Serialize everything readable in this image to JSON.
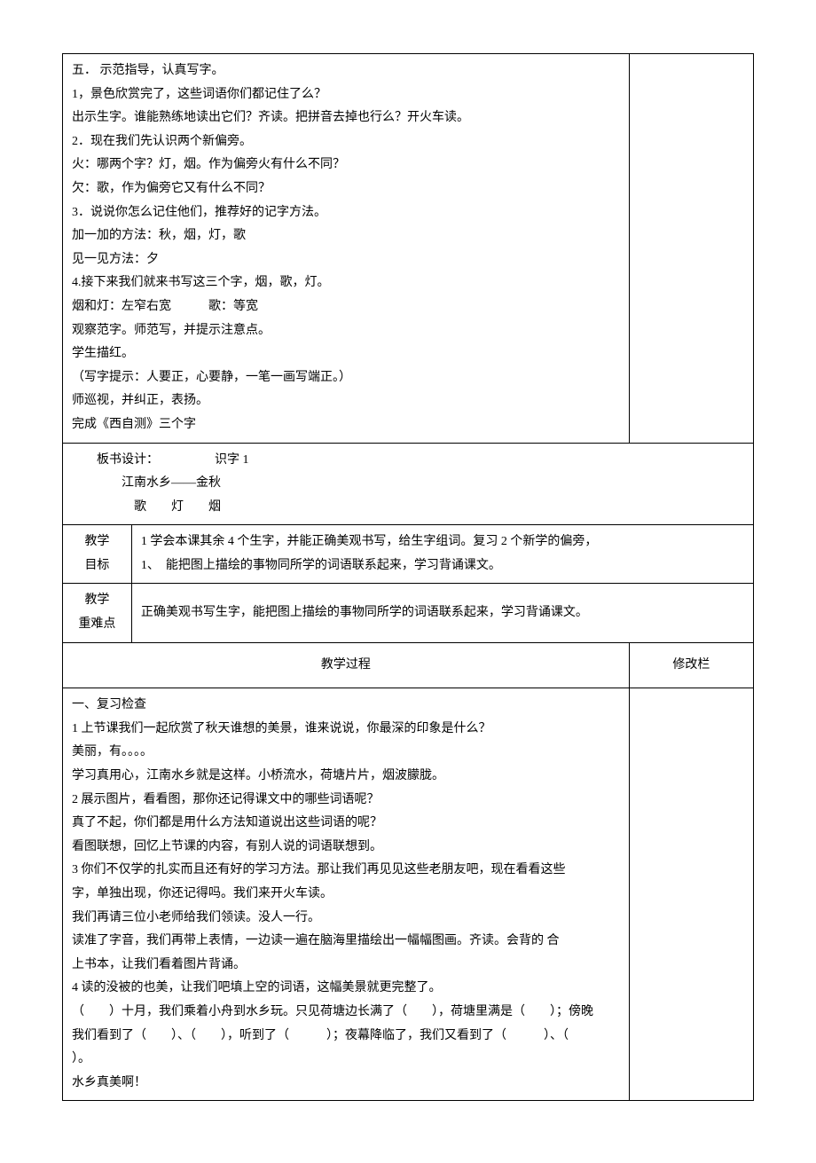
{
  "section1": {
    "lines": [
      "五．    示范指导，认真写字。",
      "1，景色欣赏完了，这些词语你们都记住了么？",
      "出示生字。谁能熟练地读出它们？齐读。把拼音去掉也行么？开火车读。",
      "2．现在我们先认识两个新偏旁。",
      "火：哪两个字？灯，烟。作为偏旁火有什么不同？",
      "欠：歌，作为偏旁它又有什么不同？",
      "3．说说你怎么记住他们，推荐好的记字方法。",
      "加一加的方法：秋，烟，灯，歌",
      "见一见方法：夕",
      "4.接下来我们就来书写这三个字，烟，歌，灯。",
      "烟和灯：左窄右宽　　　歌：等宽",
      "观察范字。师范写，并提示注意点。",
      "学生描红。",
      "（写字提示：人要正，心要静，一笔一画写端正。）",
      "师巡视，并纠正，表扬。",
      "完成《西自测》三个字"
    ]
  },
  "board": {
    "l1": "板书设计：　　　　　识字 1",
    "l2": "江南水乡——金秋",
    "l3": "歌　　灯　　烟"
  },
  "goals": {
    "label": "教学\n目标",
    "l1": "1 学会本课其余 4 个生字，并能正确美观书写，给生字组词。复习 2 个新学的偏旁，",
    "l2": "1、　能把图上描绘的事物同所学的词语联系起来，学习背诵课文。"
  },
  "difficulty": {
    "label": "教学\n重难点",
    "text": "正确美观书写生字，能把图上描绘的事物同所学的词语联系起来，学习背诵课文。"
  },
  "procHeader": {
    "left": "教学过程",
    "right": "修改栏"
  },
  "section2": {
    "lines": [
      "一、复习检查",
      "1 上节课我们一起欣赏了秋天谁想的美景，谁来说说，你最深的印象是什么？",
      "美丽，有。。。。",
      "学习真用心，江南水乡就是这样。小桥流水，荷塘片片，烟波朦胧。",
      "2 展示图片，看看图，那你还记得课文中的哪些词语呢？",
      "真了不起，你们都是用什么方法知道说出这些词语的呢？",
      "看图联想，回忆上节课的内容，有别人说的词语联想到。",
      "3 你们不仅学的扎实而且还有好的学习方法。那让我们再见见这些老朋友吧，现在看看这些",
      "字，单独出现，你还记得吗。我们来开火车读。",
      "我们再请三位小老师给我们领读。没人一行。",
      "读准了字音，我们再带上表情，一边读一遍在脑海里描绘出一幅幅图画。齐读。会背的 合",
      "上书本，让我们看着图片背诵。",
      "4 读的没被的也美，让我们吧填上空的词语，这幅美景就更完整了。",
      "（　　）十月，我们乘着小舟到水乡玩。只见荷塘边长满了（　　），荷塘里满是（　　）；傍晚",
      "我们看到了（　　）、（　　），听到了（　　　）；夜幕降临了，我们又看到了（　　　）、（　　　）。",
      "水乡真美啊！"
    ]
  }
}
